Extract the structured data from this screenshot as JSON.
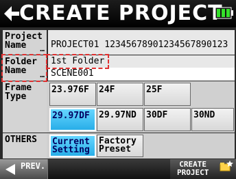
{
  "title": "CREATE PROJECT",
  "fields": {
    "project": {
      "label": "Project\nName",
      "dots": "…",
      "value": "PROJECT01 12345678901234567890123"
    },
    "folder": {
      "label": "Folder\nName",
      "dots": "…",
      "value_top": "1st Folder",
      "value": "SCENE001"
    }
  },
  "frame_type": {
    "label": "Frame\nType",
    "row1": [
      "23.976F",
      "24F",
      "25F"
    ],
    "row2": [
      "29.97DF",
      "29.97ND",
      "30DF",
      "30ND"
    ],
    "selected": "29.97DF"
  },
  "others": {
    "label": "OTHERS",
    "current_setting": [
      "Current",
      "Setting"
    ],
    "factory_preset": [
      "Factory",
      "Preset"
    ],
    "selected": "Current Setting"
  },
  "bottom": {
    "prev_label": "PREV.",
    "create_label": [
      "CREATE",
      "PROJECT"
    ]
  },
  "colors": {
    "selected": "#28aee8",
    "annotation": "#e03030",
    "battery": "#35e02a"
  },
  "icons": [
    "back-arrow-icon",
    "battery-icon",
    "prev-arrow-icon",
    "create-project-icon"
  ]
}
